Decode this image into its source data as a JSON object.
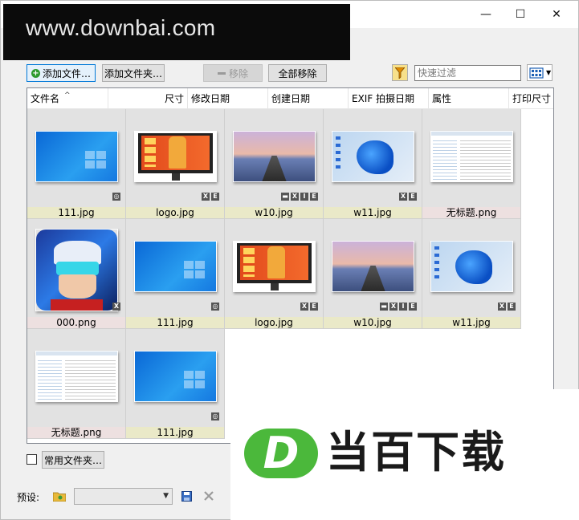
{
  "watermark": {
    "text": "www.downbai.com"
  },
  "titlebar": {
    "minimize": "—",
    "maximize": "☐",
    "close": "✕"
  },
  "toolbar": {
    "add_file": "添加文件…",
    "add_folder": "添加文件夹…",
    "remove": "移除",
    "remove_all": "全部移除",
    "filter_placeholder": "快速过滤"
  },
  "columns": [
    "文件名",
    "尺寸",
    "修改日期",
    "创建日期",
    "EXIF 拍摄日期",
    "属性",
    "打印尺寸"
  ],
  "files": [
    {
      "name": "111.jpg",
      "thumb": "win10",
      "badges": [
        "◎"
      ],
      "caption_color": "yellow"
    },
    {
      "name": "logo.jpg",
      "thumb": "monitor",
      "badges": [
        "X",
        "E"
      ],
      "caption_color": "yellow"
    },
    {
      "name": "w10.jpg",
      "thumb": "pier",
      "badges": [
        "▬",
        "X",
        "I",
        "E"
      ],
      "caption_color": "yellow"
    },
    {
      "name": "w11.jpg",
      "thumb": "win11",
      "badges": [
        "X",
        "E"
      ],
      "caption_color": "yellow"
    },
    {
      "name": "无标题.png",
      "thumb": "screenshot",
      "badges": [],
      "caption_color": "pink"
    },
    {
      "name": "000.png",
      "thumb": "character",
      "badges": [
        "X"
      ],
      "caption_color": "pink"
    },
    {
      "name": "111.jpg",
      "thumb": "win10",
      "badges": [
        "◎"
      ],
      "caption_color": "yellow"
    },
    {
      "name": "logo.jpg",
      "thumb": "monitor",
      "badges": [
        "X",
        "E"
      ],
      "caption_color": "yellow"
    },
    {
      "name": "w10.jpg",
      "thumb": "pier",
      "badges": [
        "▬",
        "X",
        "I",
        "E"
      ],
      "caption_color": "yellow"
    },
    {
      "name": "w11.jpg",
      "thumb": "win11",
      "badges": [
        "X",
        "E"
      ],
      "caption_color": "yellow"
    },
    {
      "name": "无标题.png",
      "thumb": "screenshot",
      "badges": [],
      "caption_color": "pink"
    },
    {
      "name": "111.jpg",
      "thumb": "win10",
      "badges": [
        "◎"
      ],
      "caption_color": "yellow"
    }
  ],
  "bottom": {
    "common_folder": "常用文件夹…",
    "preset_label": "预设:",
    "preset_value": ""
  },
  "logo": {
    "letter": "D",
    "text": "当百下载"
  },
  "colors": {
    "accent": "#0078d7",
    "logo_green": "#4bb83b",
    "caption_yellow": "#eae9c8",
    "caption_pink": "#ede0e0"
  }
}
